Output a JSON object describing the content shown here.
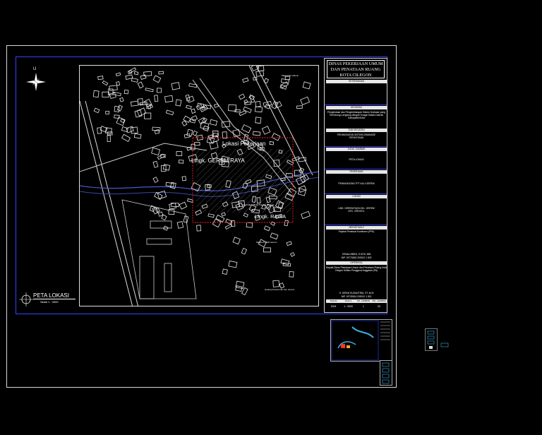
{
  "title_block": {
    "agency_lines": [
      "DINAS PEKERJAAN UMUM",
      "DAN PENATAAN RUANG",
      "KOTA CILEGON"
    ],
    "keterangan_label": "KETERANGAN",
    "kegiatan_label": "KEGIATAN",
    "kegiatan_text": "Pengelolaan dan Pengembangan Sistem Drainase yang Terhubung Langsung dengan Sungai Dalam Daerah Kabupaten/Kota",
    "sub_kegiatan_label": "SUB KEGIATAN",
    "sub_kegiatan_text": "PENINGKATAN SISTEM DRAINASE PERKOTAAN",
    "judul_gambar_label": "JUDUL GAMBAR",
    "judul_gambar_text": "PETA LOKASI",
    "pekerjaan_label": "PEKERJAAN",
    "pekerjaan_text": "PENINGKATAN TPT KALI GEREM",
    "lokasi_label": "LOKASI",
    "lokasi_text": "LINK. GEREM RAYA KEL. GEREM KEC. GROGOL",
    "mengetahui_label": "MENGETAHUI",
    "mengetahui_text": "Pejabat Pembuat Komitmen (PPK)",
    "signer_name": "ZENALDIMEN, S.SOS.,MM",
    "signer_nip": "NIP. 19770815 200312 1 003",
    "diperiksa_label": "DIPERIKSA",
    "diperiksa_text": "Kepala Dinas Pekerjaan Umum dan Penataan Ruang Kota Cilegon Selaku Pengguna Anggaran (PA)",
    "bottom_name": "H. DIRAN SUGANTIRA, ST.,M.Si",
    "bottom_nip": "NIP. 19730814 200012 1 002",
    "table_headers": [
      "TAHUN",
      "SKALA",
      "NO. LEMBAR",
      "JML. LEMBAR"
    ],
    "table_values": [
      "2024",
      "1 : 3000",
      "1",
      "20"
    ]
  },
  "map": {
    "label_lokasi": "Lokasi Pekerjaan",
    "label_gerem": "Lingk. GEREM RAYA",
    "label_rawa": "Lingk. RAWA",
    "small_label_1": "Masjid Nur Alamin",
    "small_label_2": "Perumahan Bukit Pondok Tanjung",
    "small_label_3": "Masjid Al-Islah Gerem",
    "small_label_4": "Gedung Pertemuan Kel. Gerem",
    "compass_letter": "U"
  },
  "legend": {
    "title": "PETA LOKASI",
    "scale": "Skala  1 : 3000"
  },
  "colors": {
    "frame_blue": "#3344ff",
    "highlight_red": "#ff2020",
    "building_white": "#e8e8e8"
  }
}
